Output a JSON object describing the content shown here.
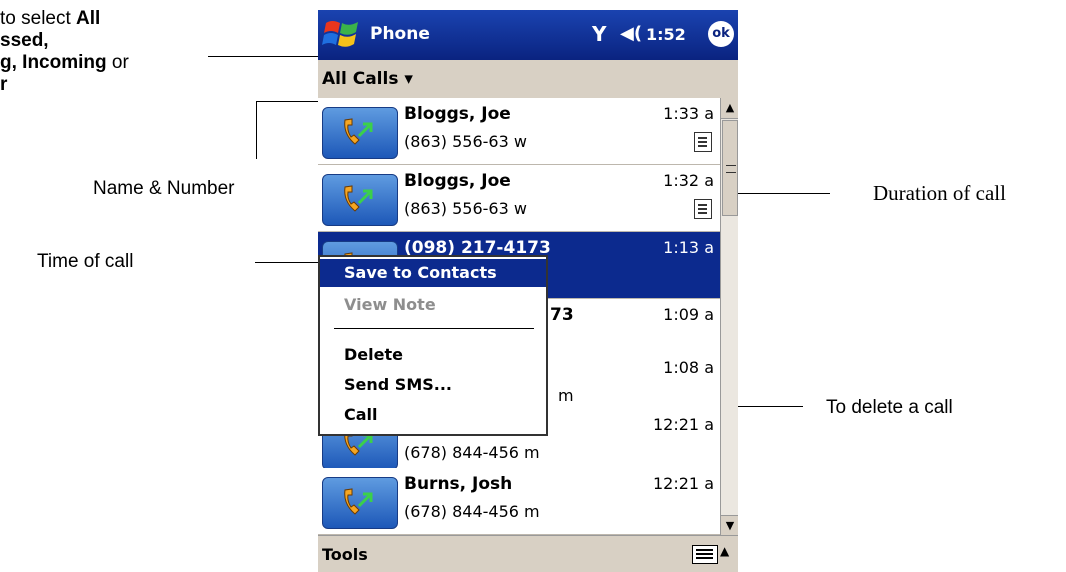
{
  "annotations": {
    "filter_note": {
      "line1": "to select ",
      "line1_bold": "All",
      "line2_bold": "ssed,",
      "line3_bold": "g, Incoming",
      "line3_tail": " or",
      "line4_bold": "r"
    },
    "name_number": "Name & Number",
    "time_of_call": "Time of call",
    "duration_of_call": "Duration of call",
    "delete_call": "To delete a call"
  },
  "titlebar": {
    "app": "Phone",
    "time": "1:52",
    "ok": "ok",
    "signal": "Y",
    "speaker": "◀("
  },
  "filter": {
    "label": "All Calls ▾"
  },
  "calls": [
    {
      "name": "Bloggs, Joe",
      "number": "(863) 556-63 w",
      "time": "1:33 a"
    },
    {
      "name": "Bloggs, Joe",
      "number": "(863) 556-63 w",
      "time": "1:32 a"
    },
    {
      "name": "(098) 217-4173",
      "number": "",
      "time": "1:13 a"
    },
    {
      "name": "73",
      "number": "",
      "time": "1:09 a"
    },
    {
      "name": "",
      "number": "m",
      "time": "1:08 a"
    },
    {
      "name": "",
      "number": "(678) 844-456 m",
      "time": "12:21 a"
    },
    {
      "name": "Burns, Josh",
      "number": "(678) 844-456 m",
      "time": "12:21 a"
    }
  ],
  "context_menu": {
    "items": [
      "Save to Contacts",
      "View Note",
      "Delete",
      "Send SMS...",
      "Call"
    ]
  },
  "bottombar": {
    "tools": "Tools"
  },
  "colors": {
    "selection": "#0c2a8e",
    "bar": "#d8d0c4"
  }
}
